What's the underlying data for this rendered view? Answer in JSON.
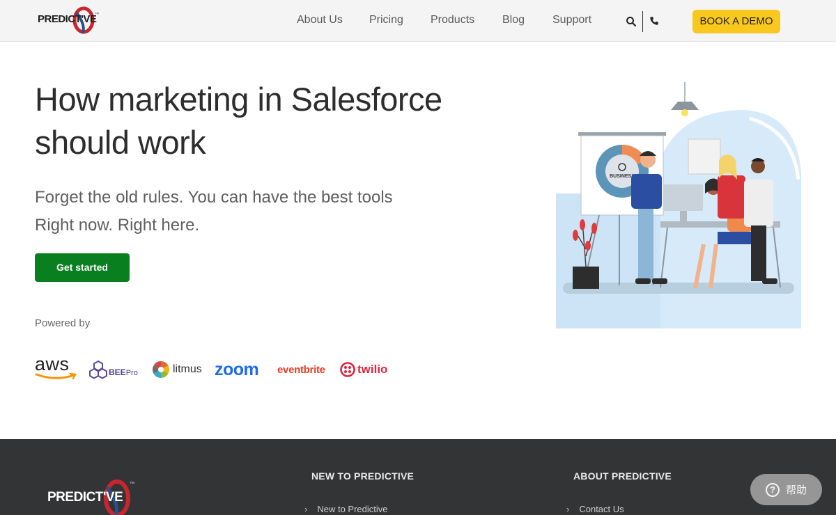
{
  "header": {
    "logo_text": "PREDICT'VE",
    "logo_tm": "™",
    "nav": [
      {
        "label": "About Us"
      },
      {
        "label": "Pricing"
      },
      {
        "label": "Products"
      },
      {
        "label": "Blog"
      },
      {
        "label": "Support"
      }
    ],
    "search_icon": "search-icon",
    "phone_icon": "phone-icon",
    "demo_label": "BOOK A DEMO"
  },
  "hero": {
    "title_line1": "How marketing in Salesforce",
    "title_line2": "should work",
    "sub_line1": "Forget the old rules. You can have the best tools",
    "sub_line2": "Right now. Right here.",
    "cta_label": "Get started",
    "powered_by": "Powered by",
    "illustration_label": "BUSINESS"
  },
  "partners": {
    "aws": "aws",
    "bee": "BEE",
    "bee_suffix": "Pro",
    "litmus": "litmus",
    "zoom": "zoom",
    "eventbrite": "eventbrite",
    "twilio": "twilio"
  },
  "footer": {
    "logo_text": "PREDICT'VE",
    "logo_tm": "™",
    "col1_heading": "NEW TO PREDICTIVE",
    "col1_link": "New to Predictive",
    "col2_heading": "ABOUT PREDICTIVE",
    "col2_link": "Contact Us"
  },
  "help_widget": {
    "label": "帮助",
    "icon": "?"
  },
  "colors": {
    "accent_yellow": "#f8c81c",
    "cta_green": "#0a7f1f",
    "footer_bg": "#333436",
    "zoom_blue": "#1c6ce8",
    "eventbrite_orange": "#e43d27",
    "twilio_red": "#e2233e"
  }
}
